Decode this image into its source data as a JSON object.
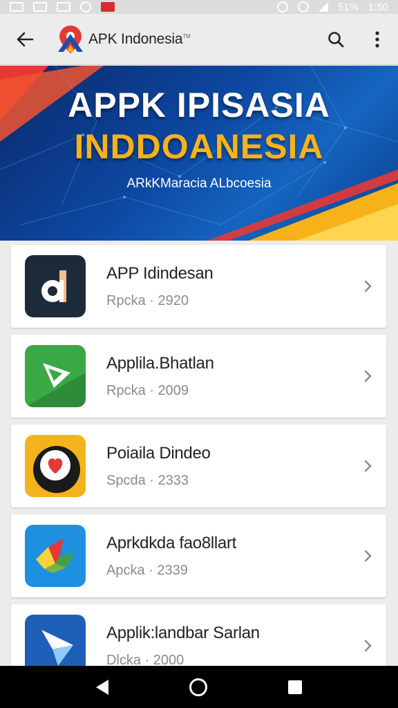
{
  "status_bar": {
    "battery_text": "51%",
    "time": "1:50"
  },
  "app_bar": {
    "title": "APK Indonesia",
    "title_mark": "TM",
    "icons": [
      "back-arrow-icon",
      "search-icon",
      "more-vert-icon"
    ]
  },
  "banner": {
    "line1": "APPK IPISASIA",
    "line2": "INDDOANESIA",
    "subtitle": "ARkKMaracia ALbcoesia"
  },
  "apps": [
    {
      "name": "APP Idindesan",
      "meta": "Rpcka · 2920",
      "icon": "dark-d-logo-icon",
      "color": "#1d2a3a"
    },
    {
      "name": "Applila.Bhatlan",
      "meta": "Rpcka · 2009",
      "icon": "green-play-logo-icon",
      "color": "#3aa845"
    },
    {
      "name": "Poiaila Dindeo",
      "meta": "Spcda · 2333",
      "icon": "yellow-heart-logo-icon",
      "color": "#f5b31b"
    },
    {
      "name": "Aprkdkda fao8llart",
      "meta": "Apcka · 2339",
      "icon": "blue-colorful-logo-icon",
      "color": "#1f8fe0"
    },
    {
      "name": "Applik:landbar Sarlan",
      "meta": "Dlcka · 2000",
      "icon": "blue-arrow-logo-icon",
      "color": "#1e5fb8"
    }
  ],
  "colors": {
    "banner_blue": "#0d47a1",
    "banner_yellow": "#f7b21a",
    "accent_red": "#e53935"
  }
}
